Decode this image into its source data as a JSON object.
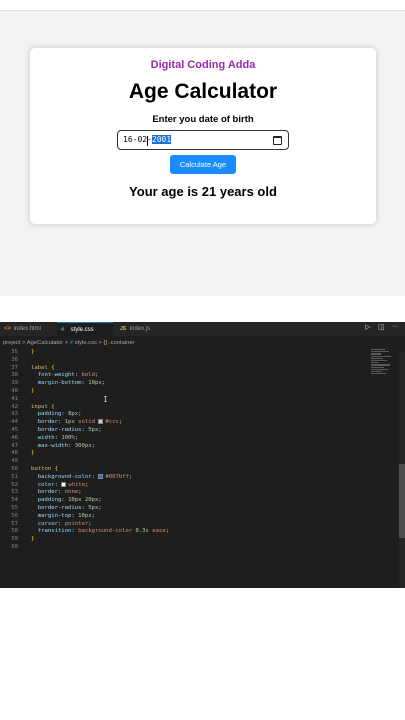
{
  "preview": {
    "brand": "Digital Coding Adda",
    "title": "Age Calculator",
    "dob_label": "Enter you date of birth",
    "date_value_prefix": "16-02-",
    "date_value_year": "2001",
    "button_label": "Calculate Age",
    "result": "Your age is 21 years old"
  },
  "editor": {
    "tabs": [
      {
        "icon": "<>",
        "label": "index.html",
        "active": false
      },
      {
        "icon": "#",
        "label": "style.css",
        "active": true
      },
      {
        "icon": "JS",
        "label": "index.js",
        "active": false
      }
    ],
    "controls": {
      "run": "▷",
      "split": "◫",
      "more": "···"
    },
    "breadcrumbs": {
      "parts": [
        "project",
        "AgeCalculator",
        "style.css",
        ".container"
      ],
      "separator": ">"
    },
    "line_numbers": [
      "35",
      "36",
      "37",
      "38",
      "39",
      "40",
      "41",
      "42",
      "43",
      "44",
      "45",
      "46",
      "47",
      "48",
      "49",
      "50",
      "51",
      "52",
      "53",
      "54",
      "55",
      "56",
      "57",
      "58",
      "59",
      "60"
    ],
    "lines": [
      [
        {
          "t": "}",
          "c": "#ffd700"
        }
      ],
      [],
      [
        {
          "t": "label ",
          "c": "#d7ba7d"
        },
        {
          "t": "{",
          "c": "#ffd700"
        }
      ],
      [
        {
          "t": "  font-weight",
          "c": "#9cdcfe"
        },
        {
          "t": ": ",
          "c": "#d4d4d4"
        },
        {
          "t": "bold",
          "c": "#ce9178"
        },
        {
          "t": ";",
          "c": "#d4d4d4"
        }
      ],
      [
        {
          "t": "  margin-bottom",
          "c": "#9cdcfe"
        },
        {
          "t": ": ",
          "c": "#d4d4d4"
        },
        {
          "t": "10px",
          "c": "#b5cea8"
        },
        {
          "t": ";",
          "c": "#d4d4d4"
        }
      ],
      [
        {
          "t": "}",
          "c": "#ffd700"
        }
      ],
      [],
      [
        {
          "t": "input ",
          "c": "#d7ba7d"
        },
        {
          "t": "{",
          "c": "#ffd700"
        }
      ],
      [
        {
          "t": "  padding",
          "c": "#9cdcfe"
        },
        {
          "t": ": ",
          "c": "#d4d4d4"
        },
        {
          "t": "8px",
          "c": "#b5cea8"
        },
        {
          "t": ";",
          "c": "#d4d4d4"
        }
      ],
      [
        {
          "t": "  border",
          "c": "#9cdcfe"
        },
        {
          "t": ": ",
          "c": "#d4d4d4"
        },
        {
          "t": "1px",
          "c": "#b5cea8"
        },
        {
          "t": " solid ",
          "c": "#ce9178"
        },
        {
          "sw": "#cccccc"
        },
        {
          "t": "#ccc",
          "c": "#ce9178"
        },
        {
          "t": ";",
          "c": "#d4d4d4"
        }
      ],
      [
        {
          "t": "  border-radius",
          "c": "#9cdcfe"
        },
        {
          "t": ": ",
          "c": "#d4d4d4"
        },
        {
          "t": "5px",
          "c": "#b5cea8"
        },
        {
          "t": ";",
          "c": "#d4d4d4"
        }
      ],
      [
        {
          "t": "  width",
          "c": "#9cdcfe"
        },
        {
          "t": ": ",
          "c": "#d4d4d4"
        },
        {
          "t": "100%",
          "c": "#b5cea8"
        },
        {
          "t": ";",
          "c": "#d4d4d4"
        }
      ],
      [
        {
          "t": "  max-width",
          "c": "#9cdcfe"
        },
        {
          "t": ": ",
          "c": "#d4d4d4"
        },
        {
          "t": "300px",
          "c": "#b5cea8"
        },
        {
          "t": ";",
          "c": "#d4d4d4"
        }
      ],
      [
        {
          "t": "}",
          "c": "#ffd700"
        }
      ],
      [],
      [
        {
          "t": "button ",
          "c": "#d7ba7d"
        },
        {
          "t": "{",
          "c": "#ffd700"
        }
      ],
      [
        {
          "t": "  background-color",
          "c": "#9cdcfe"
        },
        {
          "t": ": ",
          "c": "#d4d4d4"
        },
        {
          "sw": "#007bff"
        },
        {
          "t": "#007bff",
          "c": "#ce9178"
        },
        {
          "t": ";",
          "c": "#d4d4d4"
        }
      ],
      [
        {
          "t": "  color",
          "c": "#9cdcfe"
        },
        {
          "t": ": ",
          "c": "#d4d4d4"
        },
        {
          "sw": "#ffffff"
        },
        {
          "t": "white",
          "c": "#ce9178"
        },
        {
          "t": ";",
          "c": "#d4d4d4"
        }
      ],
      [
        {
          "t": "  border",
          "c": "#9cdcfe"
        },
        {
          "t": ": ",
          "c": "#d4d4d4"
        },
        {
          "t": "none",
          "c": "#ce9178"
        },
        {
          "t": ";",
          "c": "#d4d4d4"
        }
      ],
      [
        {
          "t": "  padding",
          "c": "#9cdcfe"
        },
        {
          "t": ": ",
          "c": "#d4d4d4"
        },
        {
          "t": "10px 20px",
          "c": "#b5cea8"
        },
        {
          "t": ";",
          "c": "#d4d4d4"
        }
      ],
      [
        {
          "t": "  border-radius",
          "c": "#9cdcfe"
        },
        {
          "t": ": ",
          "c": "#d4d4d4"
        },
        {
          "t": "5px",
          "c": "#b5cea8"
        },
        {
          "t": ";",
          "c": "#d4d4d4"
        }
      ],
      [
        {
          "t": "  margin-top",
          "c": "#9cdcfe"
        },
        {
          "t": ": ",
          "c": "#d4d4d4"
        },
        {
          "t": "10px",
          "c": "#b5cea8"
        },
        {
          "t": ";",
          "c": "#d4d4d4"
        }
      ],
      [
        {
          "t": "  cursor",
          "c": "#9cdcfe"
        },
        {
          "t": ": ",
          "c": "#d4d4d4"
        },
        {
          "t": "pointer",
          "c": "#ce9178"
        },
        {
          "t": ";",
          "c": "#d4d4d4"
        }
      ],
      [
        {
          "t": "  transition",
          "c": "#9cdcfe"
        },
        {
          "t": ": ",
          "c": "#d4d4d4"
        },
        {
          "t": "background-color ",
          "c": "#ce9178"
        },
        {
          "t": "0.3s",
          "c": "#b5cea8"
        },
        {
          "t": " ease",
          "c": "#ce9178"
        },
        {
          "t": ";",
          "c": "#d4d4d4"
        }
      ],
      [
        {
          "t": "}",
          "c": "#ffd700"
        }
      ],
      []
    ]
  },
  "colors": {
    "brand": "#9b27b0",
    "button": "#1a8cff",
    "editor_bg": "#1e1e1e"
  }
}
